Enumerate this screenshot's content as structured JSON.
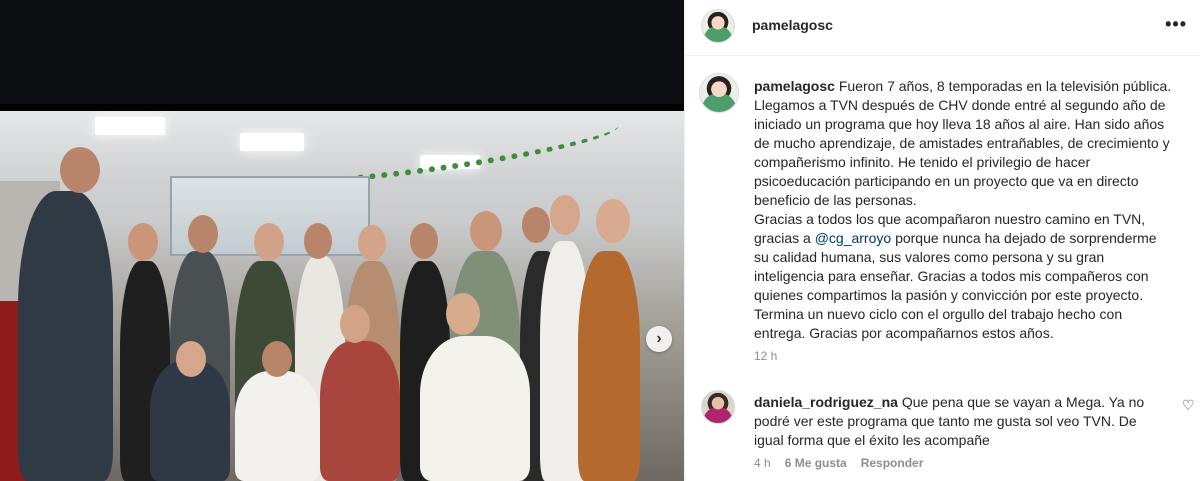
{
  "post": {
    "username": "pamelagosc",
    "more_icon": "more-horizontal-icon",
    "caption": {
      "username": "pamelagosc",
      "text_part1": "Fueron 7 años, 8 temporadas en la televisión pública. Llegamos a TVN después de CHV donde entré al segundo año de iniciado un programa que hoy lleva 18 años al aire. Han sido años de mucho aprendizaje, de amistades entrañables, de crecimiento y compañerismo infinito. He tenido el privilegio de hacer psicoeducación participando en un proyecto que va en directo beneficio de las personas.",
      "text_part2": "Gracias a todos los que acompañaron nuestro camino en TVN, gracias a",
      "mention": "@cg_arroyo",
      "text_part3": "porque nunca ha dejado de sorprenderme su calidad humana, sus valores como persona y su gran inteligencia para enseñar. Gracias a todos mis compañeros con quienes compartimos la pasión y convicción por este proyecto. Termina un nuevo ciclo con el orgullo del trabajo hecho con entrega. Gracias por acompañarnos estos años.",
      "time": "12 h"
    },
    "media": {
      "next_icon": "chevron-right-icon",
      "next_glyph": "›"
    }
  },
  "comment": {
    "username": "daniela_rodriguez_na",
    "text": "Que pena que se vayan a Mega. Ya no podré ver este programa que tanto me gusta sol veo TVN. De igual forma que el éxito les acompañe",
    "time": "4 h",
    "likes": "6 Me gusta",
    "reply": "Responder",
    "like_icon": "heart-outline-icon",
    "heart_glyph": "♡"
  },
  "colors": {
    "text": "#262626",
    "secondary": "#8e8e8e",
    "mention": "#00376b"
  }
}
